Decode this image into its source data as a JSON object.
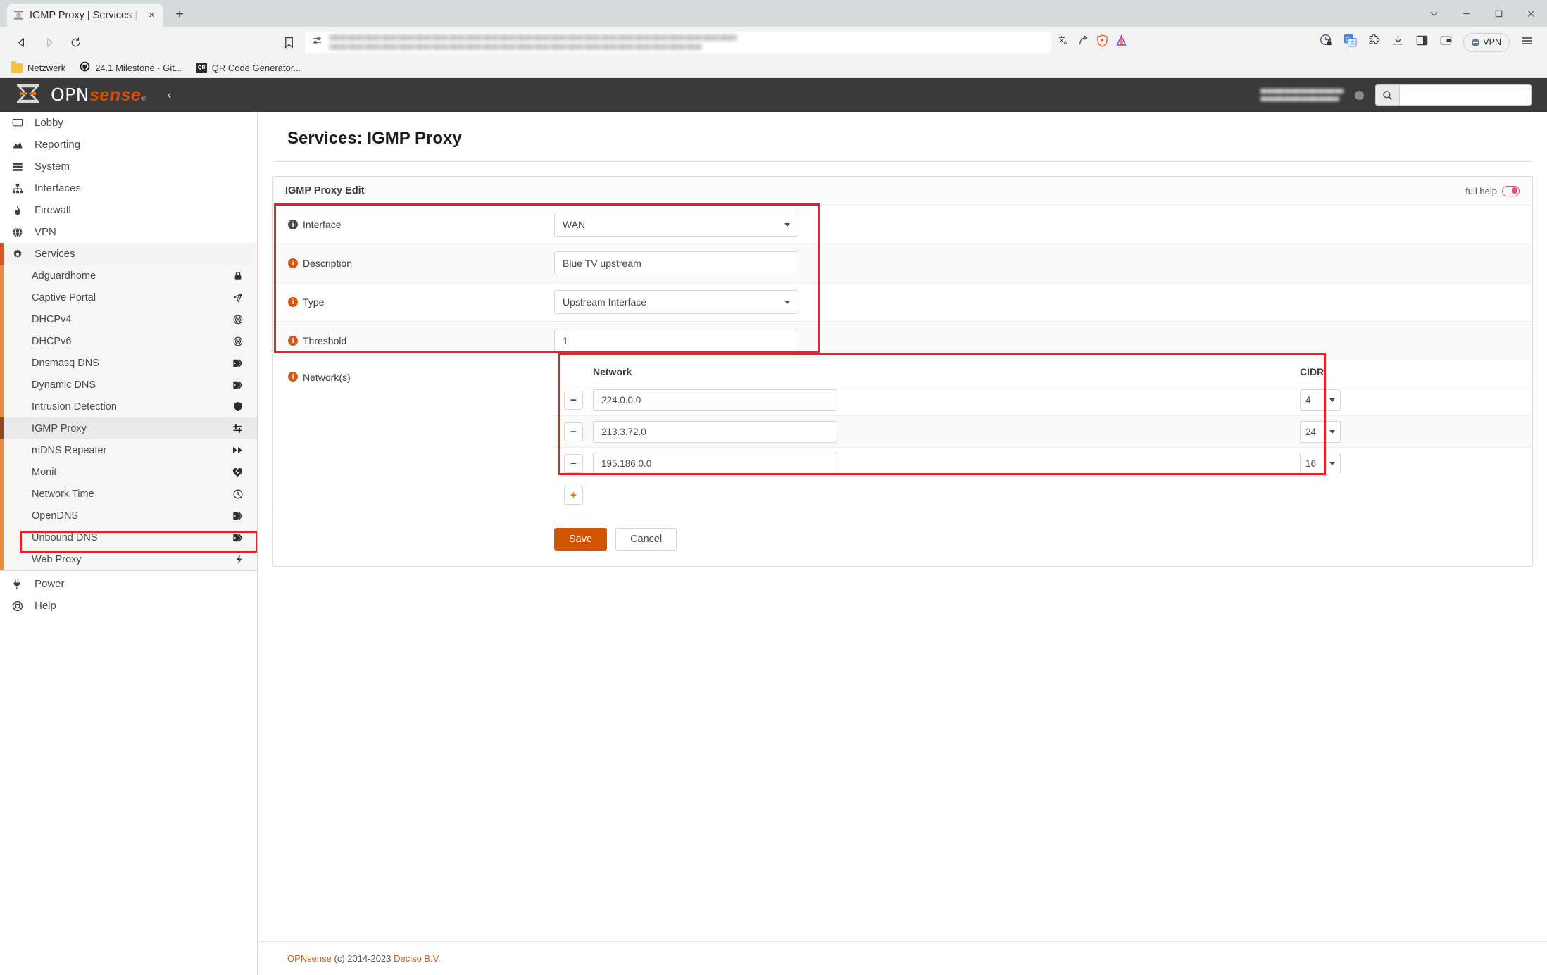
{
  "browser": {
    "tab": {
      "title": "IGMP Proxy | Services | OPNsense",
      "favicon": "opnsense-favicon",
      "close": "×"
    },
    "new_tab": "+",
    "window_controls": {
      "tab_search": "⌄",
      "minimize": "—",
      "maximize": "□",
      "close": "×"
    },
    "nav": {
      "back": "◁",
      "forward": "▷",
      "reload": "↻"
    },
    "url": {
      "value": "",
      "placeholder": ""
    },
    "vpn_label": "VPN",
    "bookmarks": [
      {
        "label": "Netzwerk",
        "icon": "folder-icon"
      },
      {
        "label": "24.1 Milestone · Git...",
        "icon": "github-icon"
      },
      {
        "label": "QR Code Generator...",
        "icon": "qr-icon"
      }
    ]
  },
  "opnsense": {
    "logo": {
      "opn": "OPN",
      "sense": "sense",
      "reg": "®"
    },
    "collapse": "‹",
    "search": {
      "value": "",
      "placeholder": ""
    },
    "page_title": "Services: IGMP Proxy",
    "sidebar": {
      "top": [
        {
          "label": "Lobby",
          "icon": "monitor-icon"
        },
        {
          "label": "Reporting",
          "icon": "chart-icon"
        },
        {
          "label": "System",
          "icon": "server-icon"
        },
        {
          "label": "Interfaces",
          "icon": "sitemap-icon"
        },
        {
          "label": "Firewall",
          "icon": "flame-icon"
        },
        {
          "label": "VPN",
          "icon": "globe-icon"
        },
        {
          "label": "Services",
          "icon": "gear-icon"
        }
      ],
      "services": [
        {
          "label": "Adguardhome",
          "icon": "lock-icon"
        },
        {
          "label": "Captive Portal",
          "icon": "paper-plane-icon"
        },
        {
          "label": "DHCPv4",
          "icon": "target-icon"
        },
        {
          "label": "DHCPv6",
          "icon": "target-icon"
        },
        {
          "label": "Dnsmasq DNS",
          "icon": "tag-icon"
        },
        {
          "label": "Dynamic DNS",
          "icon": "tag-icon"
        },
        {
          "label": "Intrusion Detection",
          "icon": "shield-icon"
        },
        {
          "label": "IGMP Proxy",
          "icon": "sliders-icon"
        },
        {
          "label": "mDNS Repeater",
          "icon": "forward-icon"
        },
        {
          "label": "Monit",
          "icon": "heartbeat-icon"
        },
        {
          "label": "Network Time",
          "icon": "clock-icon"
        },
        {
          "label": "OpenDNS",
          "icon": "tag-icon"
        },
        {
          "label": "Unbound DNS",
          "icon": "tag-icon"
        },
        {
          "label": "Web Proxy",
          "icon": "bolt-icon"
        }
      ],
      "bottom": [
        {
          "label": "Power",
          "icon": "plug-icon"
        },
        {
          "label": "Help",
          "icon": "lifering-icon"
        }
      ]
    },
    "panel": {
      "title": "IGMP Proxy Edit",
      "full_help_label": "full help",
      "fields": {
        "interface": {
          "label": "Interface",
          "value": "WAN",
          "type": "select"
        },
        "description": {
          "label": "Description",
          "value": "Blue TV upstream",
          "type": "text"
        },
        "type": {
          "label": "Type",
          "value": "Upstream Interface",
          "type": "select"
        },
        "threshold": {
          "label": "Threshold",
          "value": "1",
          "type": "text"
        }
      },
      "networks": {
        "label": "Network(s)",
        "columns": {
          "network": "Network",
          "cidr": "CIDR"
        },
        "rows": [
          {
            "network": "224.0.0.0",
            "cidr": "4",
            "remove": "−"
          },
          {
            "network": "213.3.72.0",
            "cidr": "24",
            "remove": "−"
          },
          {
            "network": "195.186.0.0",
            "cidr": "16",
            "remove": "−"
          }
        ],
        "add_label": "+"
      },
      "save_label": "Save",
      "cancel_label": "Cancel"
    },
    "footer": {
      "brand": "OPNsense",
      "copyright": "(c) 2014-2023",
      "company": "Deciso B.V."
    }
  },
  "colors": {
    "accent_orange": "#d4581c",
    "save_orange": "#d35400",
    "highlight_red": "#e8202a",
    "header_dark": "#3a3a3a"
  }
}
